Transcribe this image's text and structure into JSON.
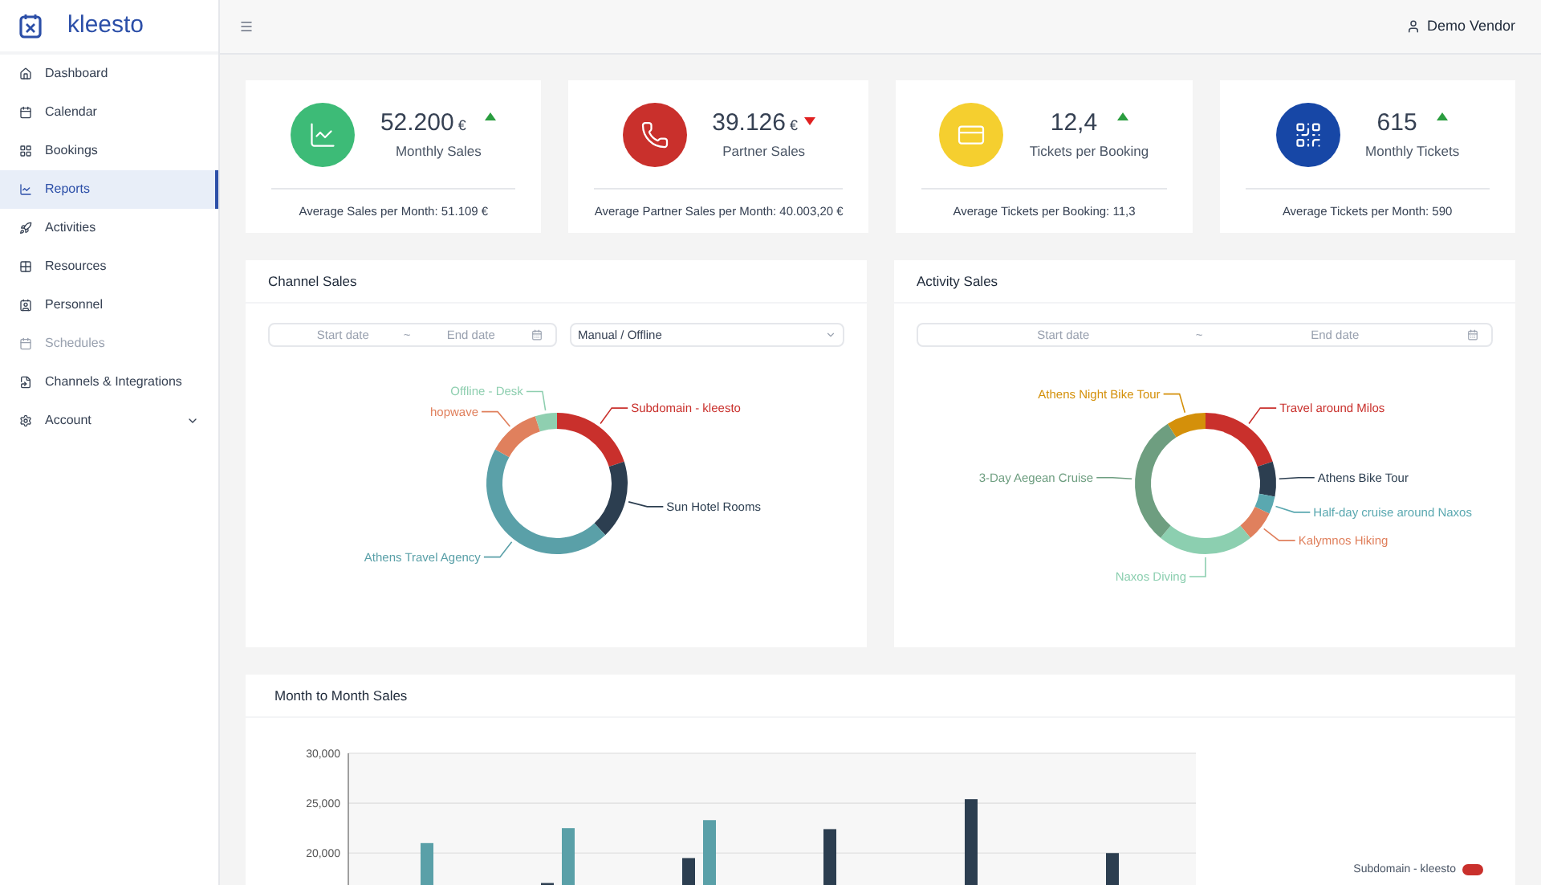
{
  "brand": {
    "name": "kleesto"
  },
  "user": {
    "name": "Demo Vendor"
  },
  "sidebar": {
    "items": [
      {
        "label": "Dashboard",
        "selected": false,
        "disabled": false,
        "expandable": false
      },
      {
        "label": "Calendar",
        "selected": false,
        "disabled": false,
        "expandable": false
      },
      {
        "label": "Bookings",
        "selected": false,
        "disabled": false,
        "expandable": false
      },
      {
        "label": "Reports",
        "selected": true,
        "disabled": false,
        "expandable": false
      },
      {
        "label": "Activities",
        "selected": false,
        "disabled": false,
        "expandable": false
      },
      {
        "label": "Resources",
        "selected": false,
        "disabled": false,
        "expandable": false
      },
      {
        "label": "Personnel",
        "selected": false,
        "disabled": false,
        "expandable": false
      },
      {
        "label": "Schedules",
        "selected": false,
        "disabled": true,
        "expandable": false
      },
      {
        "label": "Channels & Integrations",
        "selected": false,
        "disabled": false,
        "expandable": false
      },
      {
        "label": "Account",
        "selected": false,
        "disabled": false,
        "expandable": true
      }
    ]
  },
  "stats": [
    {
      "color": "#3dbb77",
      "value": "52.200",
      "unit": "€",
      "kind": "up",
      "label": "Monthly Sales",
      "footer": "Average Sales per Month: 51.109 €"
    },
    {
      "color": "#c9302c",
      "value": "39.126",
      "unit": "€",
      "kind": "down",
      "label": "Partner Sales",
      "footer": "Average Partner Sales per Month: 40.003,20 €"
    },
    {
      "color": "#f5cf2f",
      "value": "12,4",
      "kind": "up",
      "label": "Tickets per Booking",
      "footer": "Average Tickets per Booking: 11,3"
    },
    {
      "color": "#1747a6",
      "value": "615",
      "kind": "up",
      "label": "Monthly Tickets",
      "footer": "Average Tickets per Month: 590"
    }
  ],
  "channel_sales": {
    "title": "Channel Sales",
    "date_range": {
      "start": {
        "placeholder": "Start date"
      },
      "separator": "~",
      "end": {
        "placeholder": "End date"
      }
    },
    "select": {
      "value": "Manual / Offline"
    },
    "segments": [
      {
        "color": "#c9302c"
      },
      {
        "color": "#2c3e50"
      },
      {
        "color": "#5aa0a8"
      },
      {
        "color": "#e0805d"
      },
      {
        "color": "#8fcfb0"
      }
    ],
    "chart_data": {
      "type": "donut",
      "categories": [
        "Subdomain - kleesto",
        "Sun Hotel Rooms",
        "Athens Travel Agency",
        "hopwave",
        "Offline - Desk"
      ],
      "values": [
        20,
        18,
        45,
        12,
        5
      ]
    }
  },
  "activity_sales": {
    "title": "Activity Sales",
    "date_range": {
      "start": {
        "placeholder": "Start date"
      },
      "separator": "~",
      "end": {
        "placeholder": "End date"
      }
    },
    "segments": [
      {
        "color": "#c9302c"
      },
      {
        "color": "#2c3e50"
      },
      {
        "color": "#5aa8b0"
      },
      {
        "color": "#e0805d"
      },
      {
        "color": "#8ccfb0"
      },
      {
        "color": "#6e9e80"
      },
      {
        "color": "#d4900a"
      }
    ],
    "chart_data": {
      "type": "donut",
      "categories": [
        "Travel around Milos",
        "Athens Bike Tour",
        "Half-day cruise around Naxos",
        "Kalymnos Hiking",
        "Naxos Diving",
        "3-Day Aegean Cruise",
        "Athens Night Bike Tour"
      ],
      "values": [
        20,
        8,
        4,
        7,
        22,
        30,
        9
      ]
    }
  },
  "month_sales": {
    "title": "Month to Month Sales",
    "legend": [
      {
        "name": "Subdomain - kleesto",
        "color": "#c9302c"
      }
    ],
    "chart_data": {
      "type": "bar",
      "grid": true,
      "ylim": [
        16800,
        30000
      ],
      "yticks": [
        {
          "value": 20000,
          "label": "20,000"
        },
        {
          "value": 25000,
          "label": "25,000"
        },
        {
          "value": 30000,
          "label": "30,000"
        }
      ],
      "series": [
        {
          "color": "#2c3e50",
          "values": [
            null,
            17000,
            19500,
            22400,
            25400,
            20000
          ]
        },
        {
          "color": "#5aa0a8",
          "values": [
            21000,
            22500,
            23300,
            null,
            null,
            null
          ]
        }
      ]
    }
  }
}
